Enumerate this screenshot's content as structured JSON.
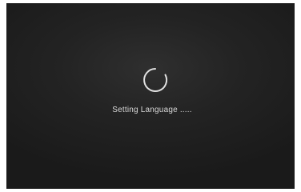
{
  "screen": {
    "spinner_icon": "loading-spinner-icon",
    "status_text": "Setting Language .....",
    "colors": {
      "background": "#1f1f1f",
      "text": "#d9d9d9",
      "spinner": "#e0e0e0"
    }
  }
}
